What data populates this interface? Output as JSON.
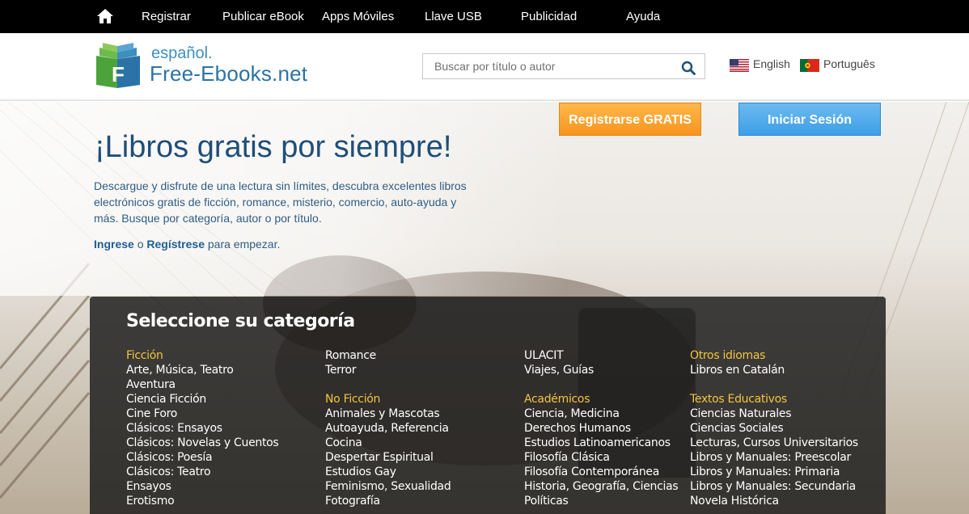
{
  "topnav": {
    "home_icon": "home-icon",
    "items": [
      "Registrar",
      "Publicar eBook",
      "Apps Móviles",
      "Llave USB",
      "Publicidad",
      "Ayuda"
    ]
  },
  "header": {
    "logo_sub": "español.",
    "logo_main": "Free-Ebooks.net",
    "search_placeholder": "Buscar por título o autor",
    "search_icon": "search-icon",
    "languages": [
      {
        "label": "English",
        "flag": "us-flag-icon"
      },
      {
        "label": "Português",
        "flag": "portugal-flag-icon"
      }
    ]
  },
  "hero": {
    "register_button": "Registrarse GRATIS",
    "login_button": "Iniciar Sesión",
    "title": "¡Libros gratis por siempre!",
    "description": "Descargue y disfrute de una lectura sin límites, descubra excelentes libros electrónicos gratis de ficción, romance, misterio, comercio, auto-ayuda y más. Busque por categoría, autor o por título.",
    "cta_login": "Ingrese",
    "cta_or": " o ",
    "cta_register": "Regístrese",
    "cta_rest": " para empezar."
  },
  "categories": {
    "title": "Seleccione su categoría",
    "columns": [
      [
        {
          "text": "Ficción",
          "head": true
        },
        {
          "text": "Arte, Música, Teatro"
        },
        {
          "text": "Aventura"
        },
        {
          "text": "Ciencia Ficción"
        },
        {
          "text": "Cine Foro"
        },
        {
          "text": "Clásicos: Ensayos"
        },
        {
          "text": "Clásicos: Novelas y Cuentos"
        },
        {
          "text": "Clásicos: Poesía"
        },
        {
          "text": "Clásicos: Teatro"
        },
        {
          "text": "Ensayos"
        },
        {
          "text": "Erotismo"
        }
      ],
      [
        {
          "text": "Romance"
        },
        {
          "text": "Terror"
        },
        {
          "gap": true
        },
        {
          "text": "No Ficción",
          "head": true
        },
        {
          "text": "Animales y Mascotas"
        },
        {
          "text": "Autoayuda, Referencia"
        },
        {
          "text": "Cocina"
        },
        {
          "text": "Despertar Espiritual"
        },
        {
          "text": "Estudios Gay"
        },
        {
          "text": "Feminismo, Sexualidad"
        },
        {
          "text": "Fotografía"
        }
      ],
      [
        {
          "text": "ULACIT"
        },
        {
          "text": "Viajes, Guías"
        },
        {
          "gap": true
        },
        {
          "text": "Académicos",
          "head": true
        },
        {
          "text": "Ciencia, Medicina"
        },
        {
          "text": "Derechos Humanos"
        },
        {
          "text": "Estudios Latinoamericanos"
        },
        {
          "text": "Filosofía Clásica"
        },
        {
          "text": "Filosofía Contemporánea"
        },
        {
          "text": "Historia, Geografía, Ciencias"
        },
        {
          "text": "Políticas"
        }
      ],
      [
        {
          "text": "Otros idiomas",
          "head": true
        },
        {
          "text": "Libros en Catalán"
        },
        {
          "gap": true
        },
        {
          "text": "Textos Educativos",
          "head": true
        },
        {
          "text": "Ciencias Naturales"
        },
        {
          "text": "Ciencias Sociales"
        },
        {
          "text": "Lecturas, Cursos Universitarios"
        },
        {
          "text": "Libros y Manuales: Preescolar"
        },
        {
          "text": "Libros y Manuales: Primaria"
        },
        {
          "text": "Libros y Manuales: Secundaria"
        },
        {
          "text": "Novela Histórica"
        }
      ]
    ]
  },
  "colors": {
    "nav_bg": "#000000",
    "title_blue": "#1f4e79",
    "register_orange": "#f7941d",
    "login_blue": "#3d9ee6",
    "category_head": "#f2c53d"
  }
}
